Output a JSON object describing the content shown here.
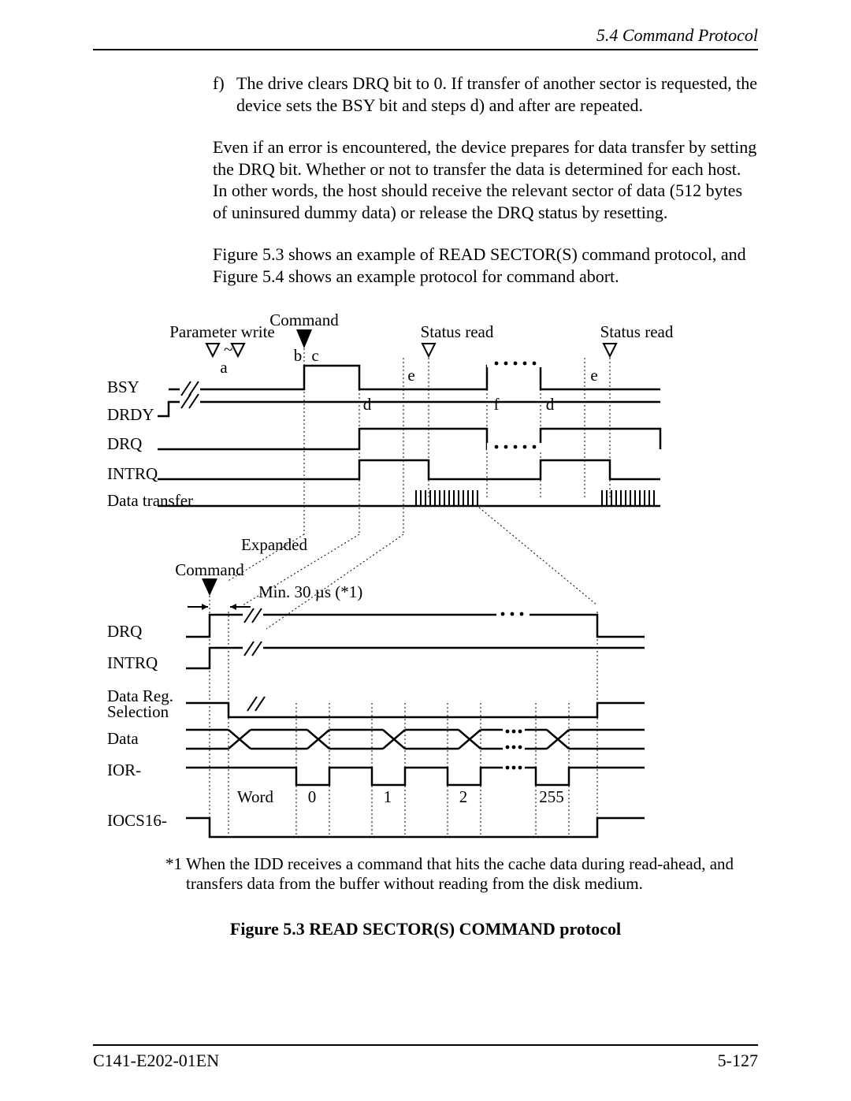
{
  "header": {
    "section": "5.4  Command Protocol"
  },
  "body": {
    "item_f_marker": "f)",
    "item_f_text": "The drive clears DRQ bit to 0.  If transfer of another sector is requested, the device sets the BSY bit and steps d) and after are repeated.",
    "para1": "Even if an error is encountered, the device prepares for data transfer by setting the DRQ bit.  Whether or not to transfer the data is determined for each host.  In other words, the host should receive the relevant sector of data (512 bytes of uninsured dummy data) or release the DRQ status by resetting.",
    "para2": "Figure 5.3 shows an example of READ SECTOR(S) command protocol, and Figure 5.4 shows an example protocol for command abort."
  },
  "diagram": {
    "top_labels": {
      "parameter_write": "Parameter write",
      "command": "Command",
      "status_read1": "Status read",
      "status_read2": "Status read",
      "a": "a",
      "b": "b",
      "c": "c",
      "d": "d",
      "e": "e",
      "f": "f"
    },
    "signals_top": [
      "BSY",
      "DRDY",
      "DRQ",
      "INTRQ",
      "Data transfer"
    ],
    "expanded_label": "Expanded",
    "command2": "Command",
    "min30": "Min. 30 µs (*1)",
    "signals_bot": [
      "DRQ",
      "INTRQ",
      "Data Reg.\nSelection",
      "Data",
      "IOR-",
      "IOCS16-"
    ],
    "word_label": "Word",
    "words": [
      "0",
      "1",
      "2",
      "255"
    ]
  },
  "footnote": {
    "star": "*1",
    "text": "When the IDD receives a command that hits the cache data during read-ahead, and transfers data from the buffer without reading from the disk medium."
  },
  "caption": "Figure 5.3  READ SECTOR(S) COMMAND protocol",
  "footer": {
    "left": "C141-E202-01EN",
    "right": "5-127"
  }
}
